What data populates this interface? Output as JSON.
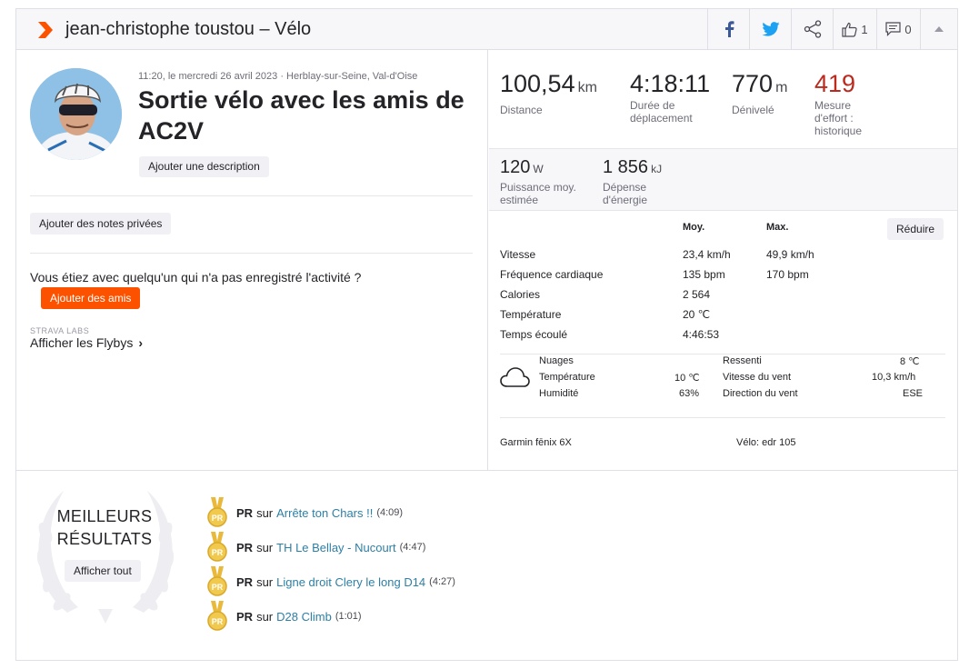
{
  "header": {
    "title": "jean-christophe toustou – Vélo",
    "likes_count": "1",
    "comments_count": "0"
  },
  "activity": {
    "date_location": "11:20, le mercredi 26 avril 2023 · Herblay-sur-Seine, Val-d'Oise",
    "title": "Sortie vélo avec les amis de AC2V",
    "add_description": "Ajouter une description",
    "add_private_notes": "Ajouter des notes privées",
    "friends_question": "Vous étiez avec quelqu'un qui n'a pas enregistré l'activité ?",
    "add_friends": "Ajouter des amis",
    "labs_label": "STRAVA LABS",
    "flybys": "Afficher les Flybys"
  },
  "primary_stats": [
    {
      "value": "100,54",
      "unit": "km",
      "label": "Distance"
    },
    {
      "value": "4:18:11",
      "unit": "",
      "label": "Durée de déplacement"
    },
    {
      "value": "770",
      "unit": "m",
      "label": "Dénivelé"
    },
    {
      "value": "419",
      "unit": "",
      "label": "Mesure d'effort : historique"
    }
  ],
  "secondary_stats": [
    {
      "value": "120",
      "unit": "W",
      "label": "Puissance moy. estimée"
    },
    {
      "value": "1 856",
      "unit": "kJ",
      "label": "Dépense d'énergie"
    }
  ],
  "details": {
    "col_avg": "Moy.",
    "col_max": "Max.",
    "reduce_label": "Réduire",
    "rows": [
      {
        "label": "Vitesse",
        "avg": "23,4 km/h",
        "max": "49,9 km/h"
      },
      {
        "label": "Fréquence cardiaque",
        "avg": "135 bpm",
        "max": "170 bpm"
      },
      {
        "label": "Calories",
        "avg": "2 564",
        "max": ""
      },
      {
        "label": "Température",
        "avg": "20 ℃",
        "max": ""
      },
      {
        "label": "Temps écoulé",
        "avg": "4:46:53",
        "max": ""
      }
    ]
  },
  "weather": {
    "condition": "Nuages",
    "temp_label": "Température",
    "temp_value": "10 ℃",
    "humidity_label": "Humidité",
    "humidity_value": "63%",
    "feels_label": "Ressenti",
    "feels_value": "8 ℃",
    "wind_speed_label": "Vitesse du vent",
    "wind_speed_value": "10,3 km/h",
    "wind_dir_label": "Direction du vent",
    "wind_dir_value": "ESE"
  },
  "device": "Garmin fēnix 6X",
  "bike": "Vélo: edr 105",
  "best_results": {
    "title_line1": "MEILLEURS",
    "title_line2": "RÉSULTATS",
    "show_all": "Afficher tout",
    "pr_label": "PR",
    "sur": "sur",
    "items": [
      {
        "segment": "Arrête ton Chars !!",
        "time": "(4:09)"
      },
      {
        "segment": "TH Le Bellay - Nucourt",
        "time": "(4:47)"
      },
      {
        "segment": "Ligne droit Clery le long D14",
        "time": "(4:27)"
      },
      {
        "segment": "D28 Climb",
        "time": "(1:01)"
      }
    ]
  },
  "colors": {
    "brand_orange": "#fc5200",
    "effort_red": "#bb2a1e",
    "link_blue": "#2d7fa5",
    "medal_gold": "#e8b93a"
  },
  "icons": [
    "strava-chevron-icon",
    "facebook-icon",
    "twitter-icon",
    "share-icon",
    "thumbs-up-icon",
    "comment-icon",
    "collapse-arrow-icon",
    "cloud-icon",
    "medal-icon",
    "laurel-wreath-icon",
    "chevron-right-icon"
  ]
}
